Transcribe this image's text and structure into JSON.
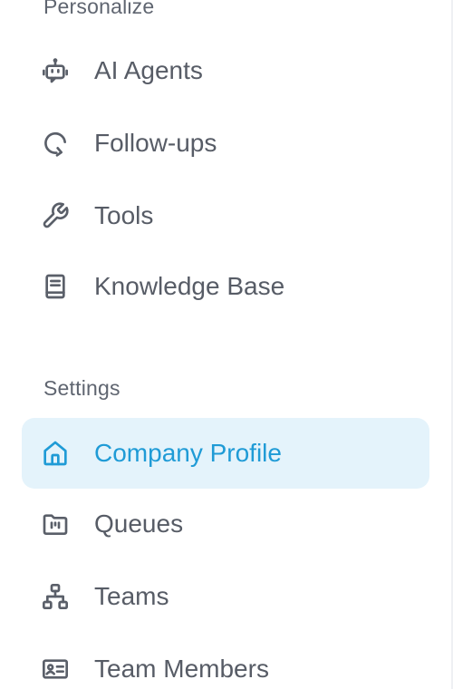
{
  "sections": {
    "personalize": "Personalize",
    "settings": "Settings"
  },
  "nav": {
    "ai_agents": {
      "label": "AI Agents",
      "icon": "robot-icon"
    },
    "followups": {
      "label": "Follow-ups",
      "icon": "refresh-arrow-icon"
    },
    "tools": {
      "label": "Tools",
      "icon": "wrench-icon"
    },
    "knowledge_base": {
      "label": "Knowledge Base",
      "icon": "book-icon"
    },
    "company_profile": {
      "label": "Company Profile",
      "icon": "home-icon",
      "active": true
    },
    "queues": {
      "label": "Queues",
      "icon": "folder-icon"
    },
    "teams": {
      "label": "Teams",
      "icon": "org-chart-icon"
    },
    "team_members": {
      "label": "Team Members",
      "icon": "id-card-icon"
    }
  },
  "colors": {
    "accent": "#1f9bd6",
    "active_bg": "#e4f3fb",
    "text": "#575c66",
    "section_text": "#5f6570"
  }
}
